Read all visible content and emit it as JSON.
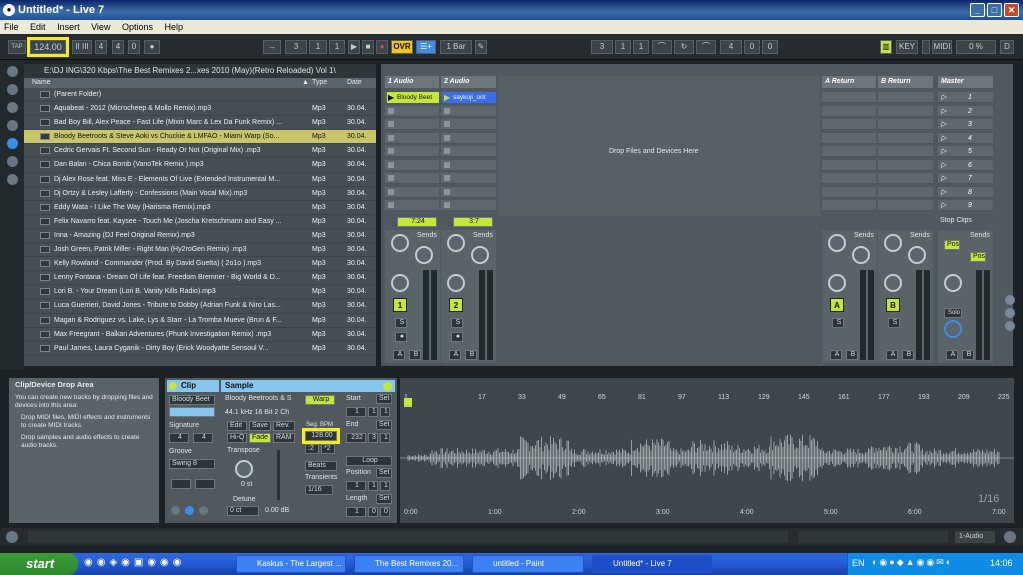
{
  "window": {
    "title": "Untitled* - Live 7",
    "min": "_",
    "max": "□",
    "close": "✕"
  },
  "menu": [
    "File",
    "Edit",
    "Insert",
    "View",
    "Options",
    "Help"
  ],
  "transport": {
    "tap": "TAP",
    "tempo": "124.00",
    "sig_a": "4",
    "sig_b": "4",
    "metro": "0",
    "arr_pos": [
      "3",
      "1",
      "1"
    ],
    "ovr": "OVR",
    "quant": "1 Bar",
    "loop_start": [
      "3",
      "1",
      "1"
    ],
    "loop_len": [
      "4",
      "0",
      "0"
    ],
    "key": "KEY",
    "midi": "MIDI",
    "cpu": "0 %",
    "d": "D"
  },
  "browser": {
    "path": "E:\\DJ ING\\320 Kbps\\The Best Remixes 2...xes 2010 (May)(Retro Reloaded) Vol 1\\",
    "cols": {
      "name": "Name",
      "type": "Type",
      "date": "Date"
    },
    "rows": [
      {
        "name": "(Parent Folder)",
        "type": "",
        "date": ""
      },
      {
        "name": "Aquabeat - 2012 (Microcheep & Mollo Remix).mp3",
        "type": "Mp3",
        "date": "30.04."
      },
      {
        "name": "Bad Boy Bill, Alex Peace - Fast Life (Mixin Marc & Lex Da Funk Remix) ...",
        "type": "Mp3",
        "date": "30.04."
      },
      {
        "name": "Bloody Beetroots & Steve Aoki vs Chuckie & LMFAO - Miami Warp (So...",
        "type": "Mp3",
        "date": "30.04."
      },
      {
        "name": "Cedric Gervais Ft. Second Sun - Ready Or Not (Original Mix) .mp3",
        "type": "Mp3",
        "date": "30.04."
      },
      {
        "name": "Dan Balan - Chica Bomb (VanoTek Remix ).mp3",
        "type": "Mp3",
        "date": "30.04."
      },
      {
        "name": "Dj Alex Rose feat. Miss E - Elements Of Live (Extended Instrumental M...",
        "type": "Mp3",
        "date": "30.04."
      },
      {
        "name": "Dj Ortzy & Lesley Lafferty - Confessions (Main Vocal Mix).mp3",
        "type": "Mp3",
        "date": "30.04."
      },
      {
        "name": "Eddy Wata - I Like The Way (Harisma Remix).mp3",
        "type": "Mp3",
        "date": "30.04."
      },
      {
        "name": "Felix Navarro feat. Kaysee - Touch Me (Joscha Kretschmann and Easy ...",
        "type": "Mp3",
        "date": "30.04."
      },
      {
        "name": "Inna - Amazing (DJ Feel Original Remix).mp3",
        "type": "Mp3",
        "date": "30.04."
      },
      {
        "name": "Josh Green, Patrik Miller - Right Man (Hy2roGen Remix) .mp3",
        "type": "Mp3",
        "date": "30.04."
      },
      {
        "name": "Kelly Rowland - Commander (Prod. By David Guetta) ( 2o1o ).mp3",
        "type": "Mp3",
        "date": "30.04."
      },
      {
        "name": "Lenny Fontana - Dream Of Life feat. Freedom Bremner - Big World & D...",
        "type": "Mp3",
        "date": "30.04."
      },
      {
        "name": "Lori B. - Your Dream (Lori B. Vanity Kills Radio).mp3",
        "type": "Mp3",
        "date": "30.04."
      },
      {
        "name": "Luca Guerrieri, David Jones - Tribute to Dobby (Adrian Funk & Niro Las...",
        "type": "Mp3",
        "date": "30.04."
      },
      {
        "name": "Magan & Rodriguez vs. Lake, Lys & Starr - La Tromba Mueve (Brun & F...",
        "type": "Mp3",
        "date": "30.04."
      },
      {
        "name": "Max Freegrant - Balkan Adventures (Phunk Investigation Remix) .mp3",
        "type": "Mp3",
        "date": "30.04."
      },
      {
        "name": "Paul James, Laura Cyganik - Dirty Boy (Erick Woodyatte Sensoul V...",
        "type": "Mp3",
        "date": "30.04."
      }
    ]
  },
  "session": {
    "tracks": [
      {
        "name": "1 Audio",
        "clip": "Bloody Beet",
        "pos": "7:24",
        "num": "1"
      },
      {
        "name": "2 Audio",
        "clip": "saykoji_orit",
        "pos": "3:7",
        "num": "2"
      }
    ],
    "drop_text": "Drop Files and Devices Here",
    "returns": [
      {
        "name": "A Return",
        "num": "A"
      },
      {
        "name": "B Return",
        "num": "B"
      }
    ],
    "master": "Master",
    "scenes": [
      "1",
      "2",
      "3",
      "4",
      "5",
      "6",
      "7",
      "8",
      "9"
    ],
    "stop_clips": "Stop Clips",
    "sends": "Sends",
    "post": "Post",
    "solo": "S",
    "a": "A",
    "b": "B",
    "solo_label": "Solo"
  },
  "info": {
    "title": "Clip/Device Drop Area",
    "body": "You can create new tracks by dropping files and devices into this area:",
    "b1": "Drop MIDI files, MIDI effects and instruments to create MIDI tracks.",
    "b2": "Drop samples and audio effects to create audio tracks."
  },
  "clip": {
    "tab": "Clip",
    "name": "Bloody Beet",
    "signature": "Signature",
    "sig_a": "4",
    "sig_b": "4",
    "groove": "Groove",
    "groove_val": "Swing 8"
  },
  "sample": {
    "tab": "Sample",
    "name": "Bloody Beetroots & S",
    "info": "44.1 kHz 16 Bit 2 Ch",
    "warp": "Warp",
    "edit": "Edit",
    "save": "Save",
    "rev": "Rev.",
    "hiq": "Hi-Q",
    "fade": "Fade",
    "ram": "RAM",
    "seg_bpm": "Seg. BPM",
    "bpm": "128.00",
    "transpose": "Transpose",
    "transpose_val": "0 st",
    "detune": "Detune",
    "detune_val": "0 ct",
    "gain": "0.00 dB",
    "beats": "Beats",
    "transients": "Transients",
    "trans_val": "1/16",
    "start": "Start",
    "end": "End",
    "loop": "Loop",
    "position": "Position",
    "length": "Length",
    "set": "Set",
    "start_v": [
      "1",
      "1",
      "1"
    ],
    "end_v": [
      "232",
      "3",
      "1"
    ],
    "pos_v": [
      "1",
      "1",
      "1"
    ],
    "len_v": [
      "1",
      "0",
      "0"
    ]
  },
  "waveform": {
    "bars": [
      "1",
      "17",
      "33",
      "49",
      "65",
      "81",
      "97",
      "113",
      "129",
      "145",
      "161",
      "177",
      "193",
      "209",
      "225"
    ],
    "times": [
      "0:00",
      "1:00",
      "2:00",
      "3:00",
      "4:00",
      "5:00",
      "6:00",
      "7:00"
    ],
    "frac": "1/16"
  },
  "bottom": {
    "track": "1-Audio"
  },
  "taskbar": {
    "start": "start",
    "tasks": [
      "Kaskus - The Largest ...",
      "The Best Remixes 20...",
      "untitled - Paint",
      "Untitled* - Live 7"
    ],
    "lang": "EN",
    "time": "14:06"
  }
}
